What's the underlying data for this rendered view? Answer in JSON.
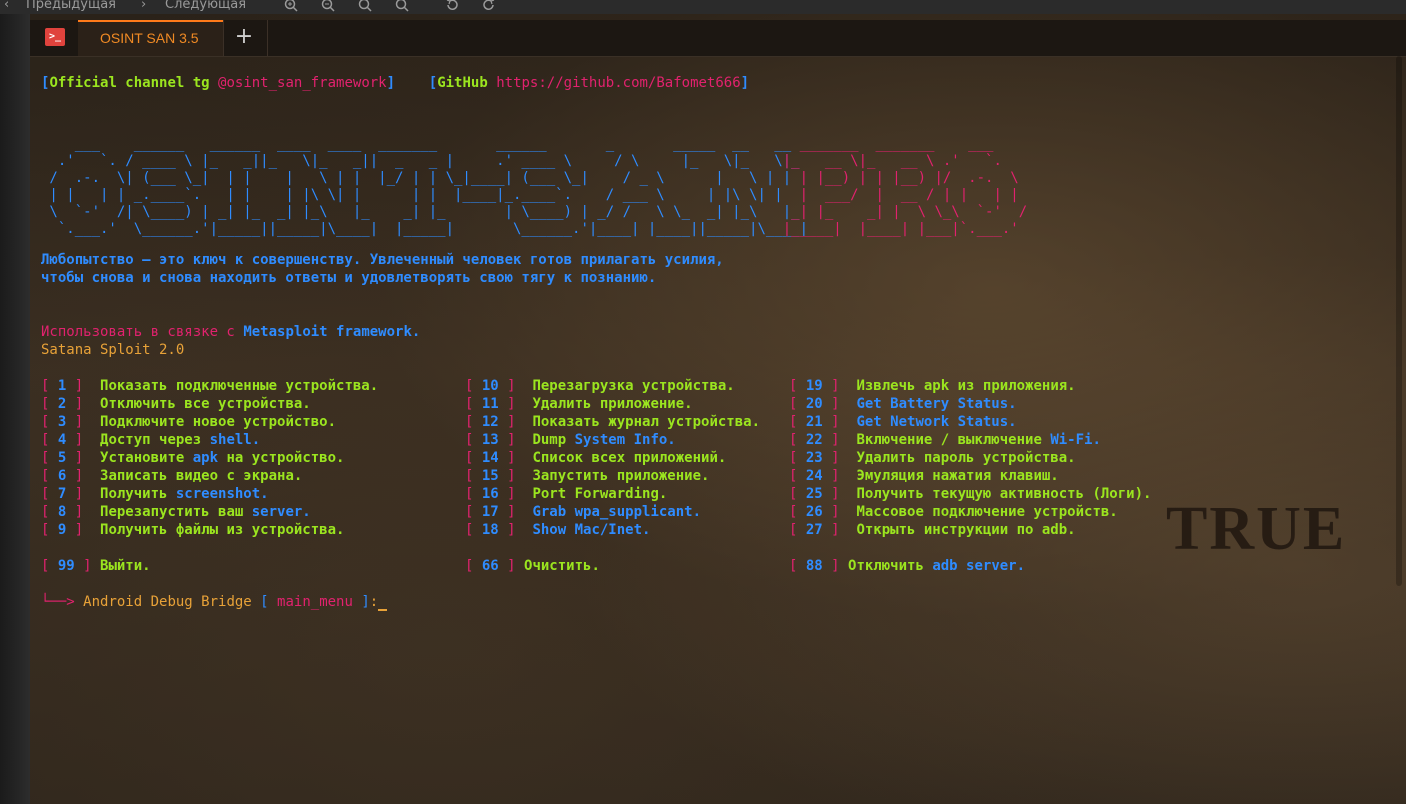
{
  "toolbar": {
    "prev_label": "Предыдущая",
    "next_label": "Следующая"
  },
  "tab": {
    "title": "OSINT SAN 3.5",
    "new_tab_symbol": "+"
  },
  "header": {
    "channel_label": "Official channel tg",
    "channel_value": "@osint_san_framework",
    "github_label": "GitHub",
    "github_value": "https://github.com/Bafomet666"
  },
  "ascii_art": {
    "blue_lines": [
      "    ___    ______   ______  ____  ____  _______       ______       _       _____  __   __",
      "  .'   `. / ____ \\ |_   _||_   \\|_   _||  _   _ |     .' ____ \\     / \\     |_   \\|_   \\|_ ",
      " /  .-.  \\| (___ \\_|  | |    |   \\ | |  |_/ | | \\_|____| (___ \\_|    / _ \\      |   \\ | |  ",
      " | |   | | _.____`.   | |    | |\\ \\| |      | |  |____|_.____`.    / ___ \\     | |\\ \\| |  ",
      " \\  `-'  /| \\____) | _| |_  _| |_\\   |_    _| |_       | \\____) | _/ /   \\ \\_  _| |_\\   |_ ",
      "  `.___.'  \\______.'|_____||_____|\\____|  |_____|       \\______.'|____| |____||_____|\\____|"
    ],
    "pink_lines": [
      "                                                                                          _______  _______    ___",
      "                                                                                        |_   __ \\|_   __ \\ .'   `.",
      "                                                                                          | |__) | | |__) |/  .-.  \\",
      "                                                                                          |  ___/  |  __ / | |   | |",
      "                                                                                         _| |_    _| |  \\ \\_\\  `-'  /",
      "                                                                                        |_____|  |____| |___|`.___.'"
    ]
  },
  "tagline": [
    "Любопытство — это ключ к совершенству. Увлеченный человек готов прилагать усилия,",
    "чтобы снова и снова находить ответы и удовлетворять свою тягу к познанию."
  ],
  "usage_prefix": "Использовать в связке с",
  "usage_framework": "Metasploit framework.",
  "sploit_version": "Satana Sploit 2.0",
  "menu": {
    "col1": [
      {
        "num": "1",
        "text": [
          {
            "t": "Показать подключенные устройства.",
            "c": "green"
          }
        ]
      },
      {
        "num": "2",
        "text": [
          {
            "t": "Отключить все устройства.",
            "c": "green"
          }
        ]
      },
      {
        "num": "3",
        "text": [
          {
            "t": "Подключите новое устройство.",
            "c": "green"
          }
        ]
      },
      {
        "num": "4",
        "text": [
          {
            "t": "Доступ через ",
            "c": "green"
          },
          {
            "t": "shell.",
            "c": "blue"
          }
        ]
      },
      {
        "num": "5",
        "text": [
          {
            "t": "Установите ",
            "c": "green"
          },
          {
            "t": "apk",
            "c": "blue"
          },
          {
            "t": " на устройство.",
            "c": "green"
          }
        ]
      },
      {
        "num": "6",
        "text": [
          {
            "t": "Записать видео с экрана.",
            "c": "green"
          }
        ]
      },
      {
        "num": "7",
        "text": [
          {
            "t": "Получить ",
            "c": "green"
          },
          {
            "t": "screenshot.",
            "c": "blue"
          }
        ]
      },
      {
        "num": "8",
        "text": [
          {
            "t": "Перезапустить ваш ",
            "c": "green"
          },
          {
            "t": "server.",
            "c": "blue"
          }
        ]
      },
      {
        "num": "9",
        "text": [
          {
            "t": "Получить файлы из устройства.",
            "c": "green"
          }
        ]
      }
    ],
    "col2": [
      {
        "num": "10",
        "text": [
          {
            "t": "Перезагрузка устройства.",
            "c": "green"
          }
        ]
      },
      {
        "num": "11",
        "text": [
          {
            "t": "Удалить приложение.",
            "c": "green"
          }
        ]
      },
      {
        "num": "12",
        "text": [
          {
            "t": "Показать журнал устройства.",
            "c": "green"
          }
        ]
      },
      {
        "num": "13",
        "text": [
          {
            "t": "Dump ",
            "c": "green"
          },
          {
            "t": "System Info.",
            "c": "blue"
          }
        ]
      },
      {
        "num": "14",
        "text": [
          {
            "t": "Список всех приложений.",
            "c": "green"
          }
        ]
      },
      {
        "num": "15",
        "text": [
          {
            "t": "Запустить приложение.",
            "c": "green"
          }
        ]
      },
      {
        "num": "16",
        "text": [
          {
            "t": "Port Forwarding.",
            "c": "green"
          }
        ]
      },
      {
        "num": "17",
        "text": [
          {
            "t": "Grab ",
            "c": "blue"
          },
          {
            "t": "wpa_supplicant.",
            "c": "blue"
          }
        ]
      },
      {
        "num": "18",
        "text": [
          {
            "t": "Show Mac/Inet.",
            "c": "blue"
          }
        ]
      }
    ],
    "col3": [
      {
        "num": "19",
        "text": [
          {
            "t": "Извлечь ",
            "c": "green"
          },
          {
            "t": "apk",
            "c": "green"
          },
          {
            "t": " из приложения.",
            "c": "green"
          }
        ]
      },
      {
        "num": "20",
        "text": [
          {
            "t": "Get Battery Status.",
            "c": "blue"
          }
        ]
      },
      {
        "num": "21",
        "text": [
          {
            "t": "Get Network Status.",
            "c": "blue"
          }
        ]
      },
      {
        "num": "22",
        "text": [
          {
            "t": "Включение / выключение ",
            "c": "green"
          },
          {
            "t": "Wi-Fi.",
            "c": "blue"
          }
        ]
      },
      {
        "num": "23",
        "text": [
          {
            "t": "Удалить пароль устройства.",
            "c": "green"
          }
        ]
      },
      {
        "num": "24",
        "text": [
          {
            "t": "Эмуляция нажатия клавиш.",
            "c": "green"
          }
        ]
      },
      {
        "num": "25",
        "text": [
          {
            "t": "Получить текущую активность (Логи).",
            "c": "green"
          }
        ]
      },
      {
        "num": "26",
        "text": [
          {
            "t": "Массовое подключение устройств.",
            "c": "green"
          }
        ]
      },
      {
        "num": "27",
        "text": [
          {
            "t": "Открыть инструкции по adb.",
            "c": "green"
          }
        ]
      }
    ],
    "extra": [
      {
        "num": "99",
        "text": [
          {
            "t": "Выйти.",
            "c": "green"
          }
        ]
      },
      {
        "num": "66",
        "text": [
          {
            "t": "Очистить.",
            "c": "green"
          }
        ]
      },
      {
        "num": "88",
        "text": [
          {
            "t": "Отключить ",
            "c": "green"
          },
          {
            "t": "adb server.",
            "c": "blue"
          }
        ]
      }
    ]
  },
  "prompt": {
    "arrow": "└──>",
    "label": "Android Debug Bridge",
    "bracket_open": "[",
    "menu_name": "main_menu",
    "bracket_close": "]",
    "suffix": ":"
  },
  "background_text": "TRUE",
  "colors": {
    "blue": "#2f8cff",
    "green": "#9be51f",
    "pink": "#e1226e",
    "orange": "#e8a238",
    "tab_accent": "#ff7a1a"
  }
}
